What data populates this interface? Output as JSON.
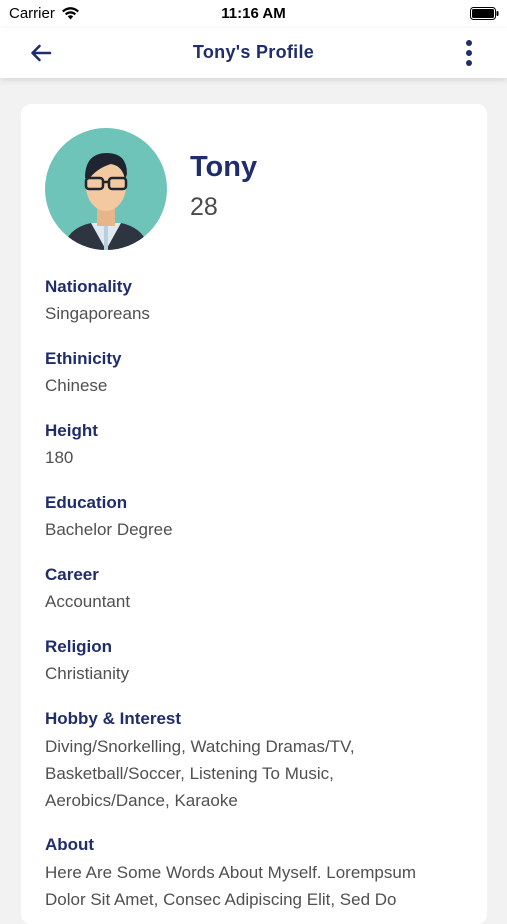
{
  "status_bar": {
    "carrier": "Carrier",
    "time": "11:16 AM"
  },
  "nav": {
    "title": "Tony's Profile",
    "back_icon": "arrow-left-icon",
    "more_icon": "more-vertical-icon"
  },
  "profile": {
    "name": "Tony",
    "age": "28"
  },
  "fields": {
    "nationality": {
      "label": "Nationality",
      "value": "Singaporeans"
    },
    "ethnicity": {
      "label": "Ethinicity",
      "value": "Chinese"
    },
    "height": {
      "label": "Height",
      "value": "180"
    },
    "education": {
      "label": "Education",
      "value": "Bachelor Degree"
    },
    "career": {
      "label": "Career",
      "value": "Accountant"
    },
    "religion": {
      "label": "Religion",
      "value": "Christianity"
    },
    "hobby": {
      "label": "Hobby & Interest",
      "line1": "Diving/Snorkelling, Watching Dramas/TV,",
      "line2": "Basketball/Soccer, Listening To Music,",
      "line3": "Aerobics/Dance, Karaoke"
    },
    "about": {
      "label": "About",
      "line1": "Here Are Some Words About Myself. Lorempsum",
      "line2": "Dolor Sit Amet, Consec Adipiscing Elit, Sed Do"
    }
  },
  "colors": {
    "accent": "#1f2d6b",
    "avatar_bg": "#6ec4b9",
    "background": "#f2f2f2"
  }
}
